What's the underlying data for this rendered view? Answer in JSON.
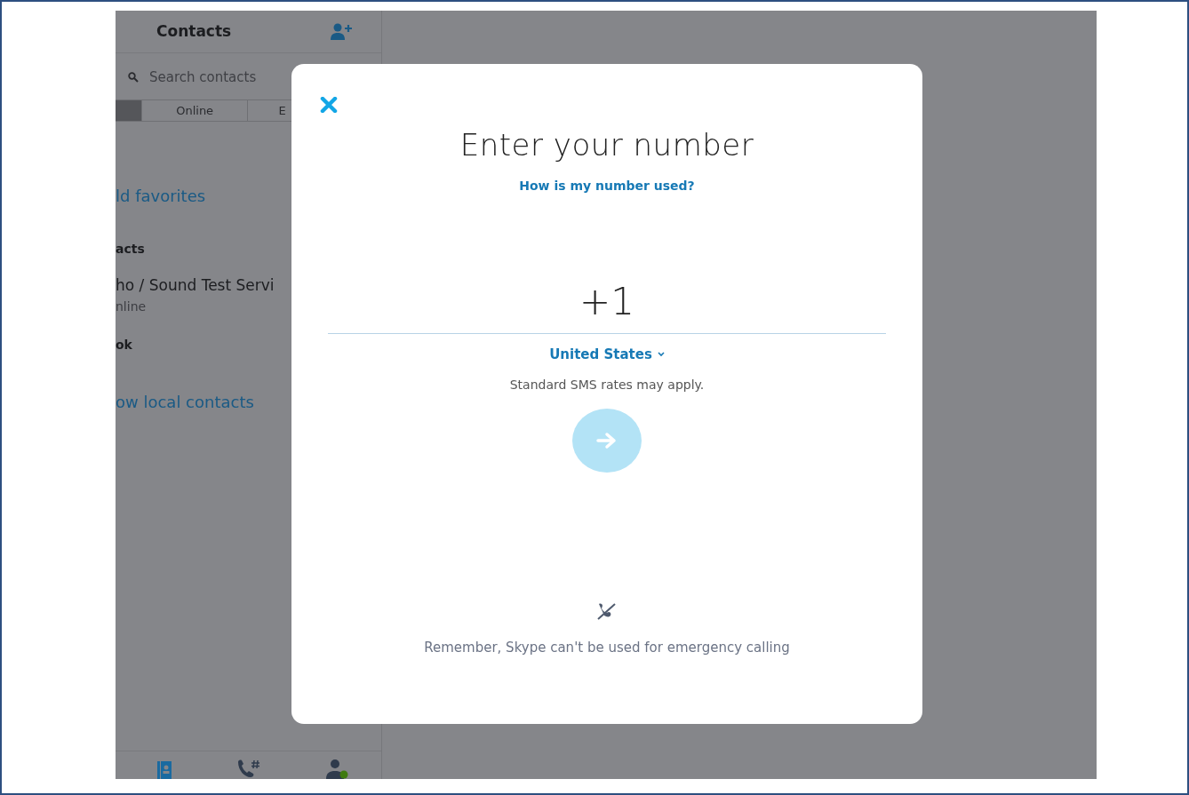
{
  "sidebar": {
    "title": "Contacts",
    "search": {
      "placeholder": "Search contacts"
    },
    "tabs": [
      {
        "selected": true
      },
      {
        "label": "Online",
        "selected": false
      },
      {
        "label": "E",
        "selected": false
      }
    ],
    "items": [
      {
        "kind": "link",
        "text": "ld favorites"
      },
      {
        "kind": "heading",
        "text": "acts"
      },
      {
        "kind": "contact",
        "text": "ho / Sound Test Servi",
        "status": "nline"
      },
      {
        "kind": "heading",
        "text": "ok"
      },
      {
        "kind": "link",
        "text": "ow local contacts"
      }
    ],
    "bottom_nav": [
      {
        "kind": "contacts",
        "selected": true
      },
      {
        "kind": "dialpad",
        "selected": false
      },
      {
        "kind": "profile",
        "selected": false
      }
    ]
  },
  "dialog": {
    "title": "Enter your number",
    "help_link": "How is my number used?",
    "phone": {
      "value": "+1"
    },
    "country": "United States",
    "note": "Standard SMS rates may apply.",
    "next_button": {
      "disabled": true
    },
    "footer_note": "Remember, Skype can't be used for emergency calling"
  }
}
